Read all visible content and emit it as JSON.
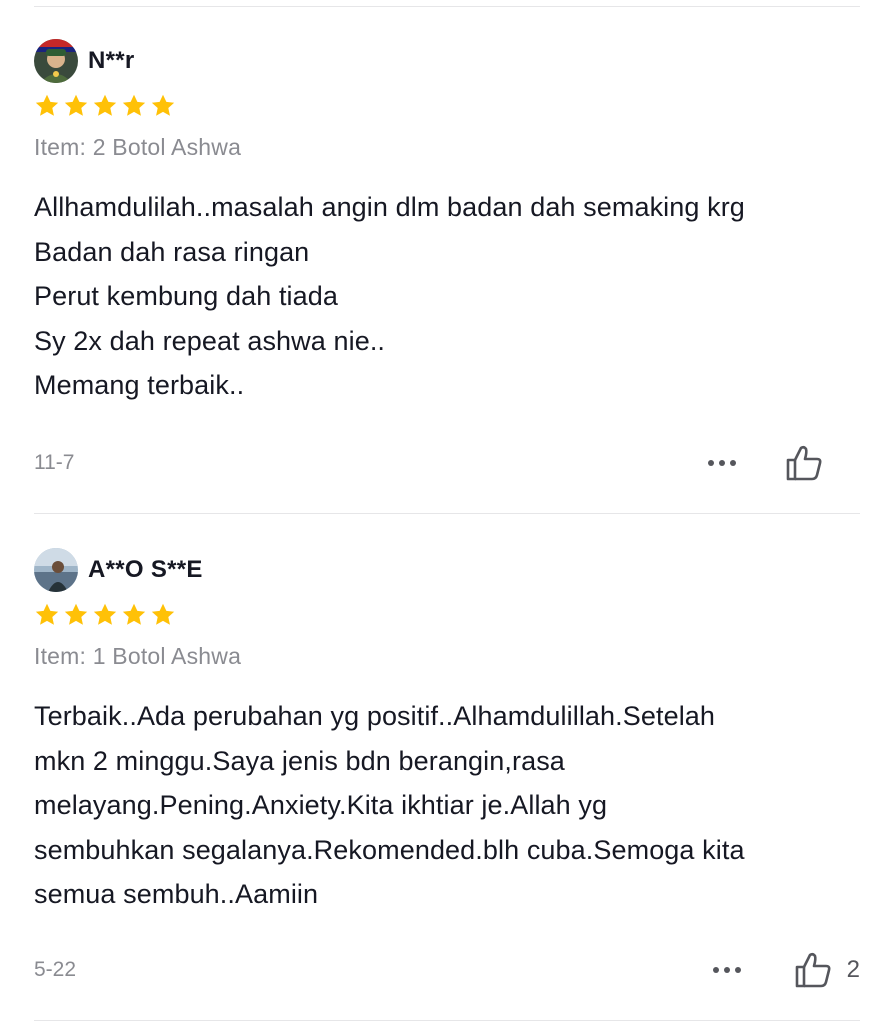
{
  "colors": {
    "star": "#FFC107",
    "text": "#161823",
    "muted": "#8A8B91",
    "divider": "#E6E6E8"
  },
  "reviews": [
    {
      "username": "N**r",
      "avatar_icon": "avatar-user-photo",
      "rating": 5,
      "item": "Item: 2 Botol Ashwa",
      "lines": [
        "Allhamdulilah..masalah angin dlm badan dah semaking krg",
        "Badan dah rasa ringan",
        "Perut kembung dah tiada",
        "Sy 2x dah repeat ashwa nie..",
        "Memang terbaik.."
      ],
      "date": "11-7",
      "likes": ""
    },
    {
      "username": "A**O S**E",
      "avatar_icon": "avatar-user-photo",
      "rating": 5,
      "item": "Item: 1 Botol Ashwa",
      "lines": [
        "Terbaik..Ada perubahan yg positif..Alhamdulillah.Setelah",
        "mkn 2 minggu.Saya jenis bdn berangin,rasa",
        "melayang.Pening.Anxiety.Kita ikhtiar je.Allah yg",
        "sembuhkan segalanya.Rekomended.blh cuba.Semoga kita",
        "semua sembuh..Aamiin"
      ],
      "date": "5-22",
      "likes": "2"
    }
  ]
}
